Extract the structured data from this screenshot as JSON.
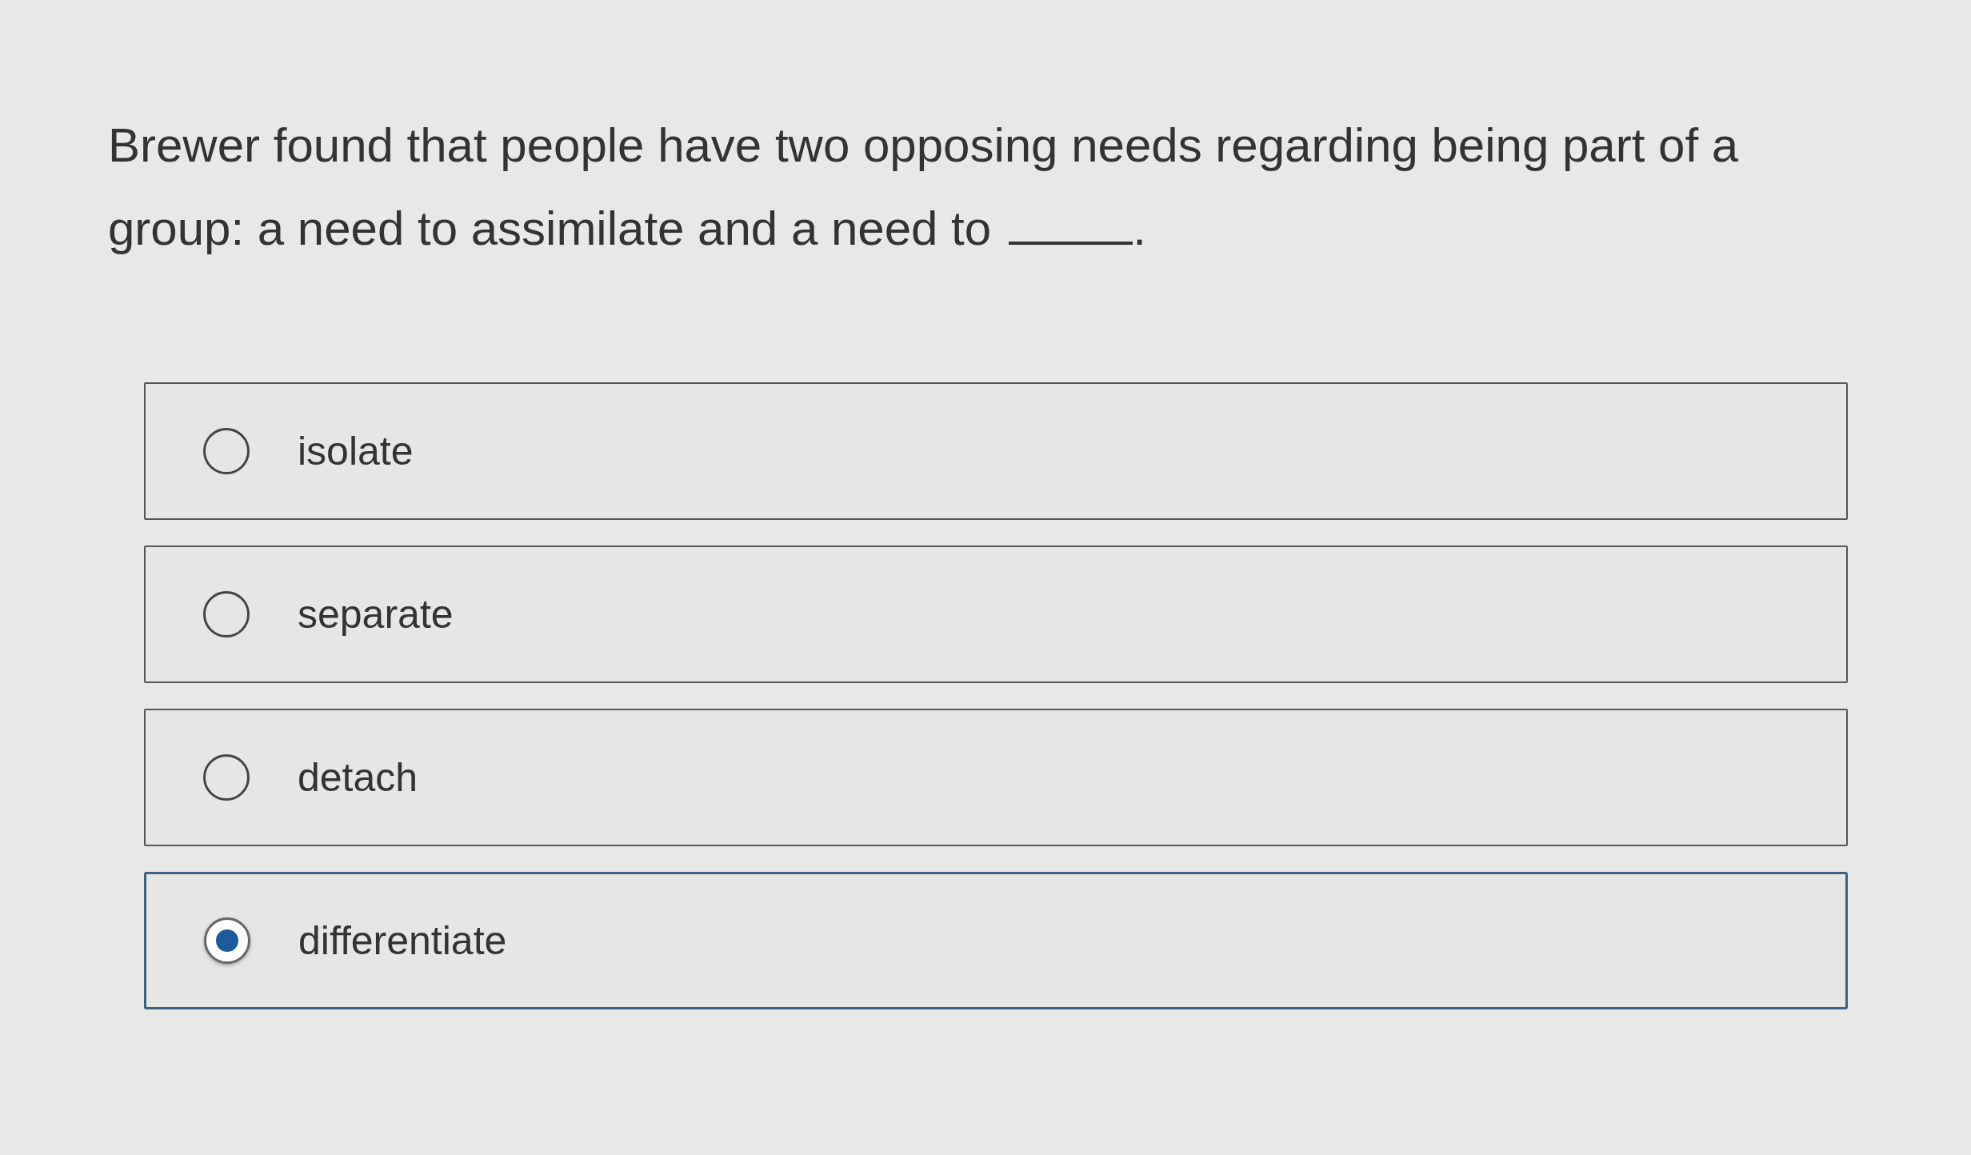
{
  "question": {
    "lines": [
      "Brewer found that people have two opposing needs regarding being part of a",
      "group: a need to assimilate and a need to"
    ],
    "text_after_blank": "."
  },
  "options": [
    {
      "label": "isolate",
      "selected": false
    },
    {
      "label": "separate",
      "selected": false
    },
    {
      "label": "detach",
      "selected": false
    },
    {
      "label": "differentiate",
      "selected": true
    }
  ]
}
